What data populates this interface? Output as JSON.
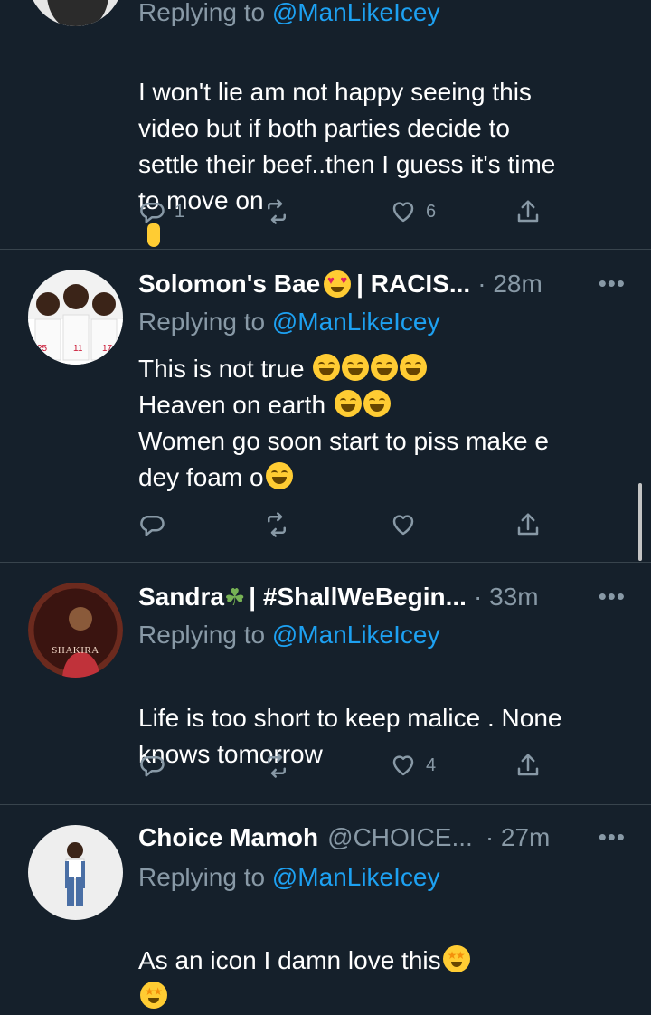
{
  "colors": {
    "background": "#15202b",
    "divider": "#38444d",
    "secondary_text": "#8899a6",
    "link": "#1da1f2"
  },
  "tweets": [
    {
      "name": "",
      "handle": "",
      "time": "",
      "replying_label": "Replying to",
      "replying_handle": "@ManLikeIcey",
      "text": "I won't lie am not happy seeing this\nvideo but if both parties decide to\nsettle their beef..then I guess it's time\nto move on",
      "emojis": [
        "crossed-fingers"
      ],
      "reply_count": "1",
      "retweet_count": "",
      "like_count": "6"
    },
    {
      "name": "Solomon's Bae",
      "name_suffix": "| RACIS...",
      "handle": "",
      "time": "· 28m",
      "replying_label": "Replying to",
      "replying_handle": "@ManLikeIcey",
      "line1": "This is not true",
      "line2": "Heaven on earth",
      "line3": "Women go soon start to piss make e",
      "line4": "dey foam o",
      "reply_count": "",
      "retweet_count": "",
      "like_count": ""
    },
    {
      "name": "Sandra",
      "name_suffix": "| #ShallWeBegin...",
      "handle": "",
      "time": "· 33m",
      "replying_label": "Replying to",
      "replying_handle": "@ManLikeIcey",
      "text": "Life is too short to keep malice . None\nknows tomorrow",
      "avatar_text": "SHAKIRA",
      "reply_count": "",
      "retweet_count": "",
      "like_count": "4"
    },
    {
      "name": "Choice Mamoh",
      "handle": "@CHOICE...",
      "time": "· 27m",
      "replying_label": "Replying to",
      "replying_handle": "@ManLikeIcey",
      "text": "As an icon I damn love this",
      "reply_count": "",
      "retweet_count": "",
      "like_count": ""
    }
  ],
  "more_label": "•••",
  "icons": {
    "reply": "reply-icon",
    "retweet": "retweet-icon",
    "like": "heart-icon",
    "share": "share-icon",
    "more": "more-icon"
  }
}
